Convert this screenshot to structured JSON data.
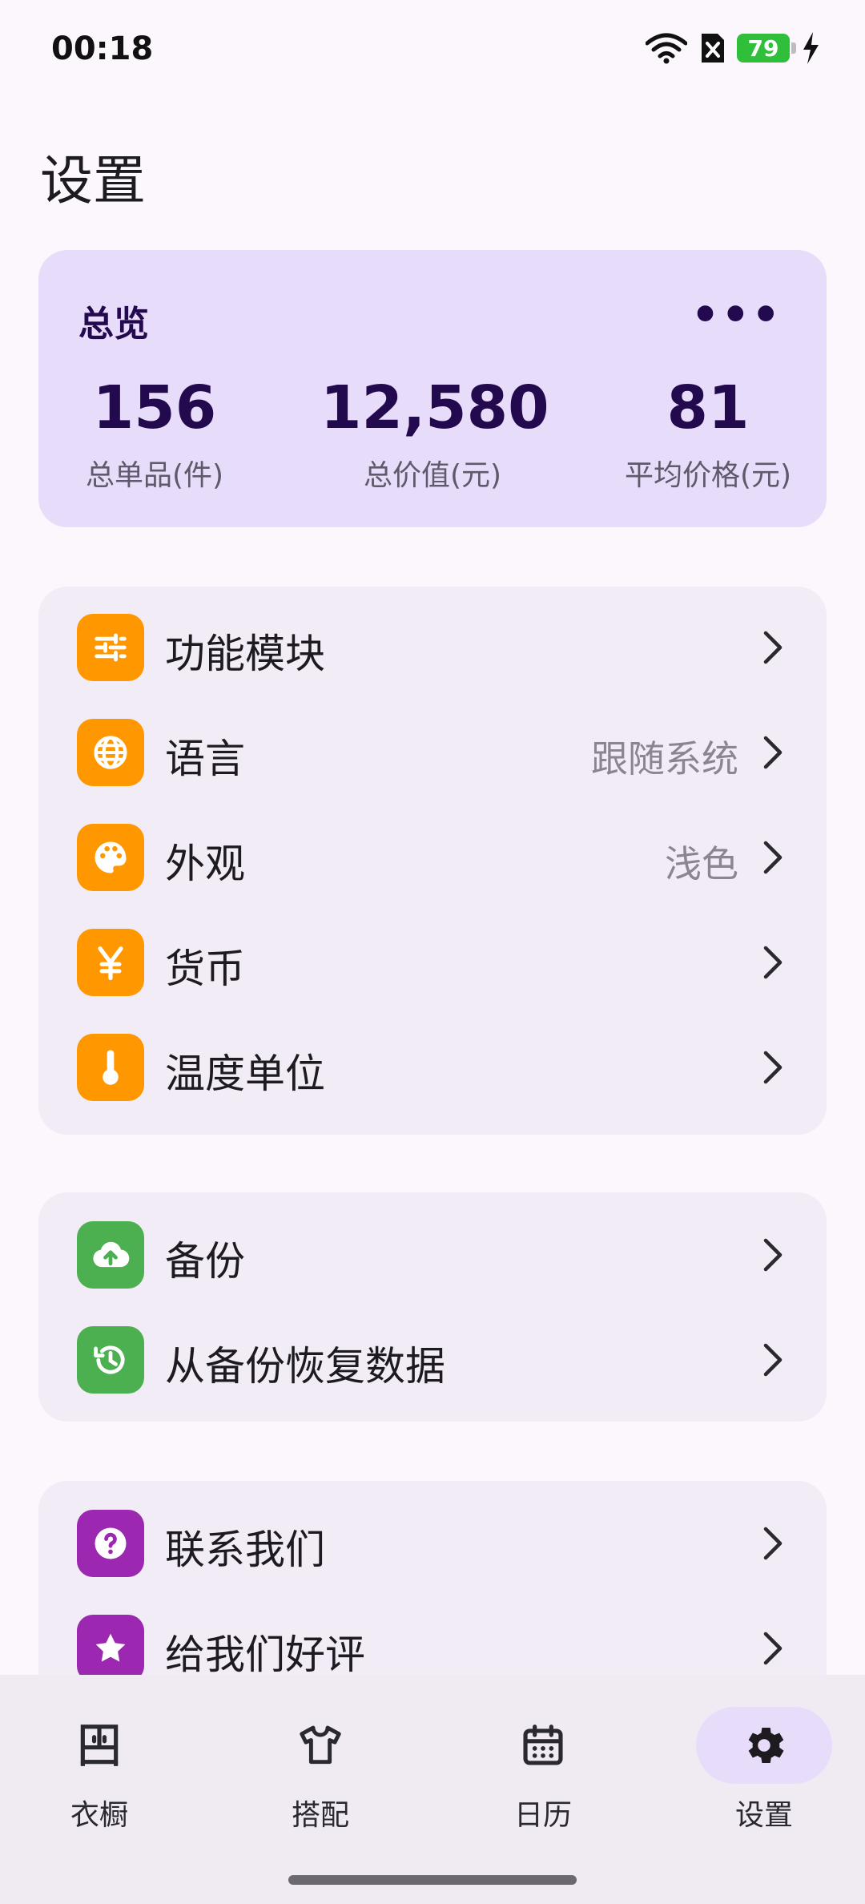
{
  "status_bar": {
    "time": "00:18",
    "battery": "79"
  },
  "page_title": "设置",
  "overview": {
    "title": "总览",
    "more": "•••",
    "stats": [
      {
        "value": "156",
        "label": "总单品(件)"
      },
      {
        "value": "12,580",
        "label": "总价值(元)"
      },
      {
        "value": "81",
        "label": "平均价格(元)"
      }
    ]
  },
  "groups": {
    "general": [
      {
        "label": "功能模块",
        "value": "",
        "icon": "tune-icon"
      },
      {
        "label": "语言",
        "value": "跟随系统",
        "icon": "globe-icon"
      },
      {
        "label": "外观",
        "value": "浅色",
        "icon": "palette-icon"
      },
      {
        "label": "货币",
        "value": "",
        "icon": "yen-icon"
      },
      {
        "label": "温度单位",
        "value": "",
        "icon": "thermometer-icon"
      }
    ],
    "backup": [
      {
        "label": "备份",
        "icon": "cloud-upload-icon"
      },
      {
        "label": "从备份恢复数据",
        "icon": "restore-icon"
      }
    ],
    "about": [
      {
        "label": "联系我们",
        "icon": "help-icon"
      },
      {
        "label": "给我们好评",
        "icon": "star-icon"
      }
    ]
  },
  "bottom_nav": [
    {
      "label": "衣橱",
      "icon": "wardrobe-icon"
    },
    {
      "label": "搭配",
      "icon": "tshirt-icon"
    },
    {
      "label": "日历",
      "icon": "calendar-icon"
    },
    {
      "label": "设置",
      "icon": "gear-icon"
    }
  ],
  "colors": {
    "background": "#fcf7fc",
    "overview_card": "#e8dcfb",
    "group_card": "#f2ecf7",
    "orange_icon": "#ff9800",
    "green_icon": "#4caf50",
    "purple_icon": "#9c27b0",
    "battery": "#2fbf3a"
  }
}
